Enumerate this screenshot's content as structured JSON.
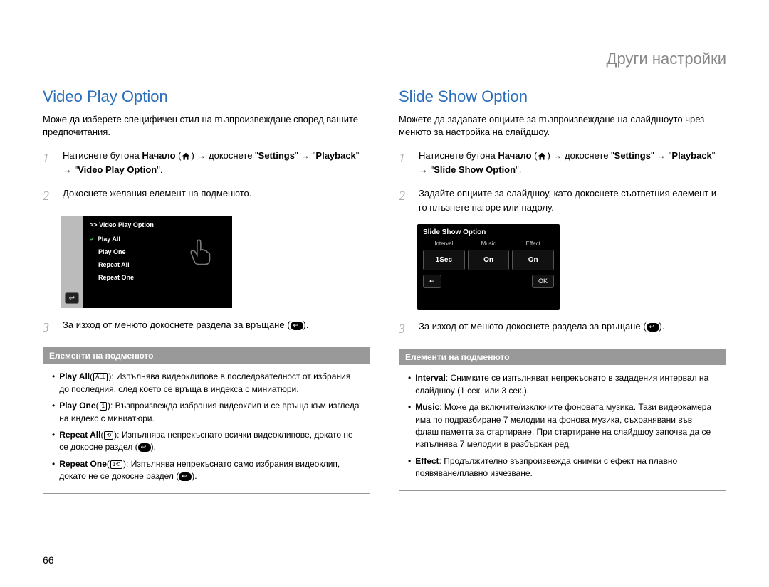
{
  "header": {
    "title": "Други настройки"
  },
  "pageNumber": "66",
  "left": {
    "title": "Video Play Option",
    "intro": "Може да изберете специфичен стил на възпроизвеждане според вашите предпочитания.",
    "step1_pre": "Натиснете бутона ",
    "step1_home_label": "Начало",
    "step1_mid": " → докоснете \"",
    "step1_settings": "Settings",
    "step1_mid2": "\" → \"",
    "step1_playback": "Playback",
    "step1_mid3": "\" → \"",
    "step1_option": "Video Play Option",
    "step1_end": "\".",
    "step2": "Докоснете желания елемент на подменюто.",
    "step3_pre": "За изход от менюто докоснете раздела за връщане (",
    "step3_post": ").",
    "screenshot": {
      "header": ">> Video Play Option",
      "items": [
        "Play All",
        "Play One",
        "Repeat All",
        "Repeat One"
      ]
    },
    "submenu": {
      "title": "Елементи на подменюто",
      "items": [
        {
          "label": "Play All",
          "icon": "ALL",
          "text": ": Изпълнява видеоклипове в последователност от избрания до последния, след което се връща в индекса с миниатюри."
        },
        {
          "label": "Play One",
          "icon": "1",
          "text": ": Възпроизвежда избрания видеоклип и се връща към изгледа на индекс с миниатюри."
        },
        {
          "label": "Repeat All",
          "icon": "⟲",
          "text": ": Изпълнява непрекъснато всички видеоклипове, докато не се докосне раздел (",
          "hasReturn": true
        },
        {
          "label": "Repeat One",
          "icon": "1⟲",
          "text": ": Изпълнява непрекъснато само избрания видеоклип, докато не се докосне раздел (",
          "hasReturn": true
        }
      ]
    }
  },
  "right": {
    "title": "Slide Show Option",
    "intro": "Можете да задавате опциите за възпроизвеждане на слайдшоуто чрез менюто за настройка на слайдшоу.",
    "step1_pre": "Натиснете бутона ",
    "step1_home_label": "Начало",
    "step1_mid": " → докоснете \"",
    "step1_settings": "Settings",
    "step1_mid2": "\" → \"",
    "step1_playback": "Playback",
    "step1_mid3": "\" → \"",
    "step1_option": "Slide Show Option",
    "step1_end": "\".",
    "step2": "Задайте опциите за слайдшоу, като докоснете съответния елемент и го плъзнете нагоре или надолу.",
    "step3_pre": "За изход от менюто докоснете раздела за връщане (",
    "step3_post": ").",
    "screenshot": {
      "title": "Slide Show Option",
      "labels": [
        "Interval",
        "Music",
        "Effect"
      ],
      "values": [
        "1Sec",
        "On",
        "On"
      ],
      "back": "↩",
      "ok": "OK"
    },
    "submenu": {
      "title": "Елементи на подменюто",
      "items": [
        {
          "label": "Interval",
          "text": ": Снимките се изпълняват непрекъснато в зададения интервал на слайдшоу (1 сек. или 3 сек.)."
        },
        {
          "label": "Music",
          "text": ": Може да включите/изключите фоновата музика. Тази видеокамера има по подразбиране 7 мелодии на фонова музика, съхранявани във флаш паметта за стартиране. При стартиране на слайдшоу започва да се изпълнява 7 мелодии в разбъркан ред."
        },
        {
          "label": "Effect",
          "text": ": Продължително възпроизвежда снимки с ефект на плавно появяване/плавно изчезване."
        }
      ]
    }
  }
}
